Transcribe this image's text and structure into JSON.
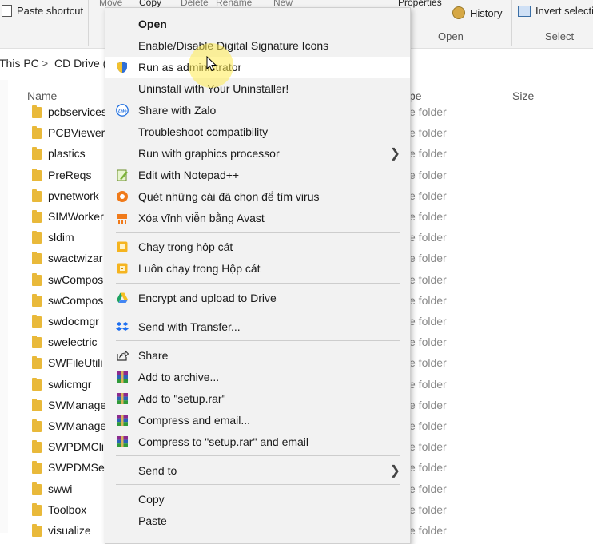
{
  "ribbon": {
    "paste_shortcut": "Paste shortcut",
    "move_label": "Move",
    "copy_label": "Copy",
    "delete_label": "Delete",
    "rename_label": "Rename",
    "new_label": "New",
    "properties_label": "Properties",
    "history_label": "History",
    "invert_selection": "Invert selection",
    "open_group": "Open",
    "select_group": "Select"
  },
  "address": {
    "this_pc": "This PC",
    "sep": ">",
    "drive": "CD Drive ("
  },
  "columns": {
    "name": "Name",
    "type": "pe",
    "size": "Size"
  },
  "files": [
    {
      "name": "pcbservices",
      "type": "e folder"
    },
    {
      "name": "PCBViewer",
      "type": "e folder"
    },
    {
      "name": "plastics",
      "type": "e folder"
    },
    {
      "name": "PreReqs",
      "type": "e folder"
    },
    {
      "name": "pvnetwork",
      "type": "e folder"
    },
    {
      "name": "SIMWorker",
      "type": "e folder"
    },
    {
      "name": "sldim",
      "type": "e folder"
    },
    {
      "name": "swactwizar",
      "type": "e folder"
    },
    {
      "name": "swCompos",
      "type": "e folder"
    },
    {
      "name": "swCompos",
      "type": "e folder"
    },
    {
      "name": "swdocmgr",
      "type": "e folder"
    },
    {
      "name": "swelectric",
      "type": "e folder"
    },
    {
      "name": "SWFileUtili",
      "type": "e folder"
    },
    {
      "name": "swlicmgr",
      "type": "e folder"
    },
    {
      "name": "SWManage",
      "type": "e folder"
    },
    {
      "name": "SWManage",
      "type": "e folder"
    },
    {
      "name": "SWPDMCli",
      "type": "e folder"
    },
    {
      "name": "SWPDMSer",
      "type": "e folder"
    },
    {
      "name": "swwi",
      "type": "e folder"
    },
    {
      "name": "Toolbox",
      "type": "e folder"
    },
    {
      "name": "visualize",
      "type": "e folder"
    }
  ],
  "menu": {
    "open": "Open",
    "digital_signature": "Enable/Disable Digital Signature Icons",
    "run_as_admin": "Run as administrator",
    "uninstall": "Uninstall with Your Uninstaller!",
    "zalo": "Share with Zalo",
    "troubleshoot": "Troubleshoot compatibility",
    "graphics": "Run with graphics processor",
    "notepad": "Edit with Notepad++",
    "scan_virus": "Quét những cái đã chọn để tìm virus",
    "avast_delete": "Xóa vĩnh viễn bằng Avast",
    "sandbox1": "Chạy trong hộp cát",
    "sandbox2": "Luôn chạy trong Hộp cát",
    "drive": "Encrypt and upload to Drive",
    "transfer": "Send with Transfer...",
    "share": "Share",
    "archive": "Add to archive...",
    "add_rar": "Add to \"setup.rar\"",
    "compress_email": "Compress and email...",
    "compress_rar_email": "Compress to \"setup.rar\" and email",
    "send_to": "Send to",
    "copy": "Copy",
    "paste": "Paste",
    "highlighted_item": "run_as_admin"
  },
  "colors": {
    "folder": "#e9b93a",
    "menu_bg": "#f2f2f2",
    "highlight": "#ffffff",
    "cursor_glow": "#ffeb50"
  }
}
